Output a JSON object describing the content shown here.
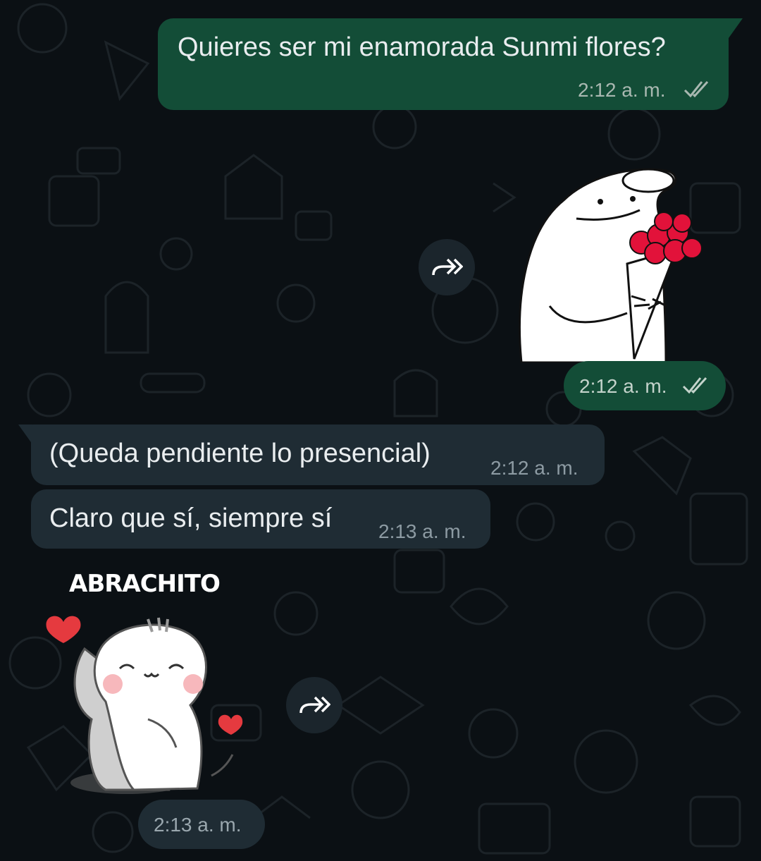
{
  "chat": {
    "messages": [
      {
        "direction": "outgoing",
        "text": "Quieres ser mi enamorada Sunmi flores?",
        "time": "2:12 a. m.",
        "status": "read"
      },
      {
        "direction": "outgoing",
        "type": "sticker",
        "sticker": "meme-flowers-sticker",
        "time": "2:12 a. m.",
        "status": "read"
      },
      {
        "direction": "incoming",
        "text": "(Queda pendiente lo presencial)",
        "time": "2:12 a. m."
      },
      {
        "direction": "incoming",
        "text": "Claro que sí, siempre sí",
        "time": "2:13 a. m."
      },
      {
        "direction": "incoming",
        "type": "sticker",
        "sticker": "hug-cats-sticker",
        "sticker_caption": "ABRACHITO",
        "time": "2:13 a. m."
      }
    ]
  },
  "colors": {
    "background": "#0b1014",
    "outgoing_bubble": "#134d37",
    "incoming_bubble": "#1f2c34",
    "read_ticks": "#a9b8b1"
  },
  "icons": [
    "forward-icon",
    "double-check-icon",
    "heart-icon"
  ]
}
